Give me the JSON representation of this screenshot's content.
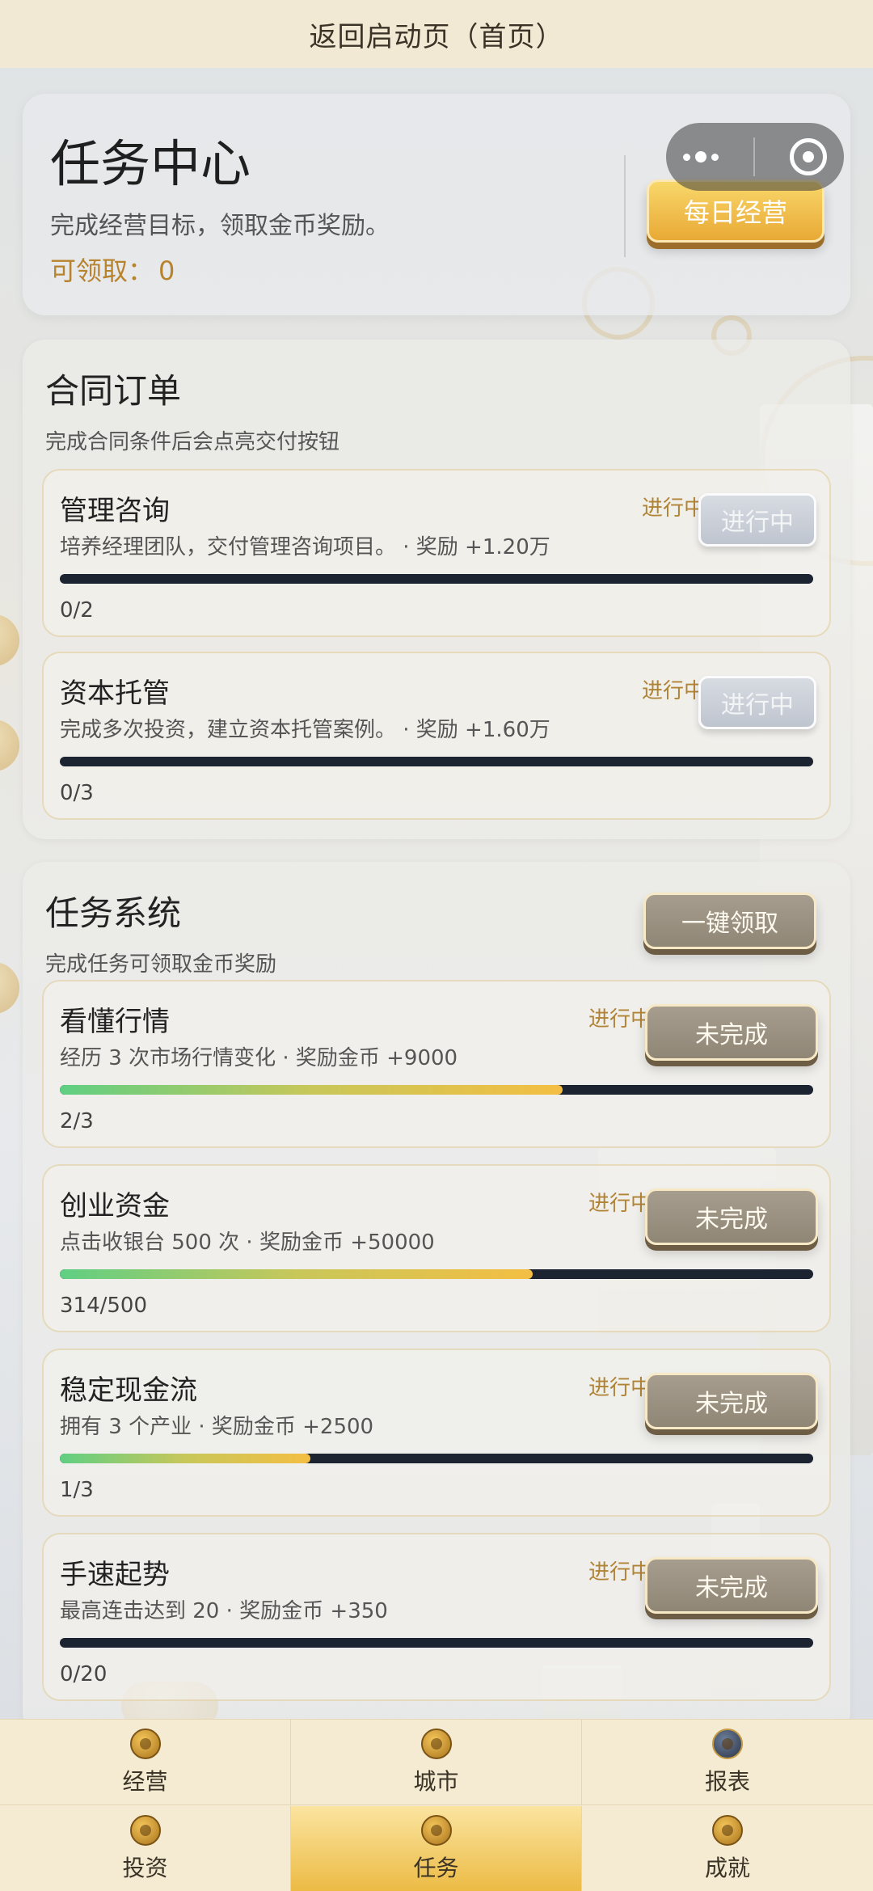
{
  "top_nav": {
    "title": "返回启动页（首页）"
  },
  "header": {
    "title": "任务中心",
    "subtitle": "完成经营目标，领取金币奖励。",
    "claimable_label": "可领取：",
    "claimable_value": "0",
    "daily_button": "每日经营"
  },
  "contracts": {
    "title": "合同订单",
    "subtitle": "完成合同条件后会点亮交付按钮",
    "items": [
      {
        "title": "管理咨询",
        "desc": "培养经理团队，交付管理咨询项目。 · 奖励 +1.20万",
        "status": "进行中",
        "button": "进行中",
        "progress": 0.0,
        "count": "0/2"
      },
      {
        "title": "资本托管",
        "desc": "完成多次投资，建立资本托管案例。 · 奖励 +1.60万",
        "status": "进行中",
        "button": "进行中",
        "progress": 0.0,
        "count": "0/3"
      }
    ]
  },
  "tasks": {
    "title": "任务系统",
    "subtitle": "完成任务可领取金币奖励",
    "claim_all": "一键领取",
    "items": [
      {
        "title": "看懂行情",
        "desc": "经历 3 次市场行情变化 · 奖励金币 +9000",
        "status": "进行中",
        "button": "未完成",
        "progress": 0.667,
        "count": "2/3"
      },
      {
        "title": "创业资金",
        "desc": "点击收银台 500 次 · 奖励金币 +50000",
        "status": "进行中",
        "button": "未完成",
        "progress": 0.628,
        "count": "314/500"
      },
      {
        "title": "稳定现金流",
        "desc": "拥有 3 个产业 · 奖励金币 +2500",
        "status": "进行中",
        "button": "未完成",
        "progress": 0.333,
        "count": "1/3"
      },
      {
        "title": "手速起势",
        "desc": "最高连击达到 20 · 奖励金币 +350",
        "status": "进行中",
        "button": "未完成",
        "progress": 0.0,
        "count": "0/20"
      }
    ]
  },
  "tabbar": {
    "items": [
      {
        "label": "经营",
        "icon": "business-icon",
        "active": false
      },
      {
        "label": "城市",
        "icon": "city-icon",
        "active": false
      },
      {
        "label": "报表",
        "icon": "report-icon",
        "active": false
      },
      {
        "label": "投资",
        "icon": "invest-icon",
        "active": false
      },
      {
        "label": "任务",
        "icon": "task-icon",
        "active": true
      },
      {
        "label": "成就",
        "icon": "achievement-icon",
        "active": false
      }
    ]
  }
}
